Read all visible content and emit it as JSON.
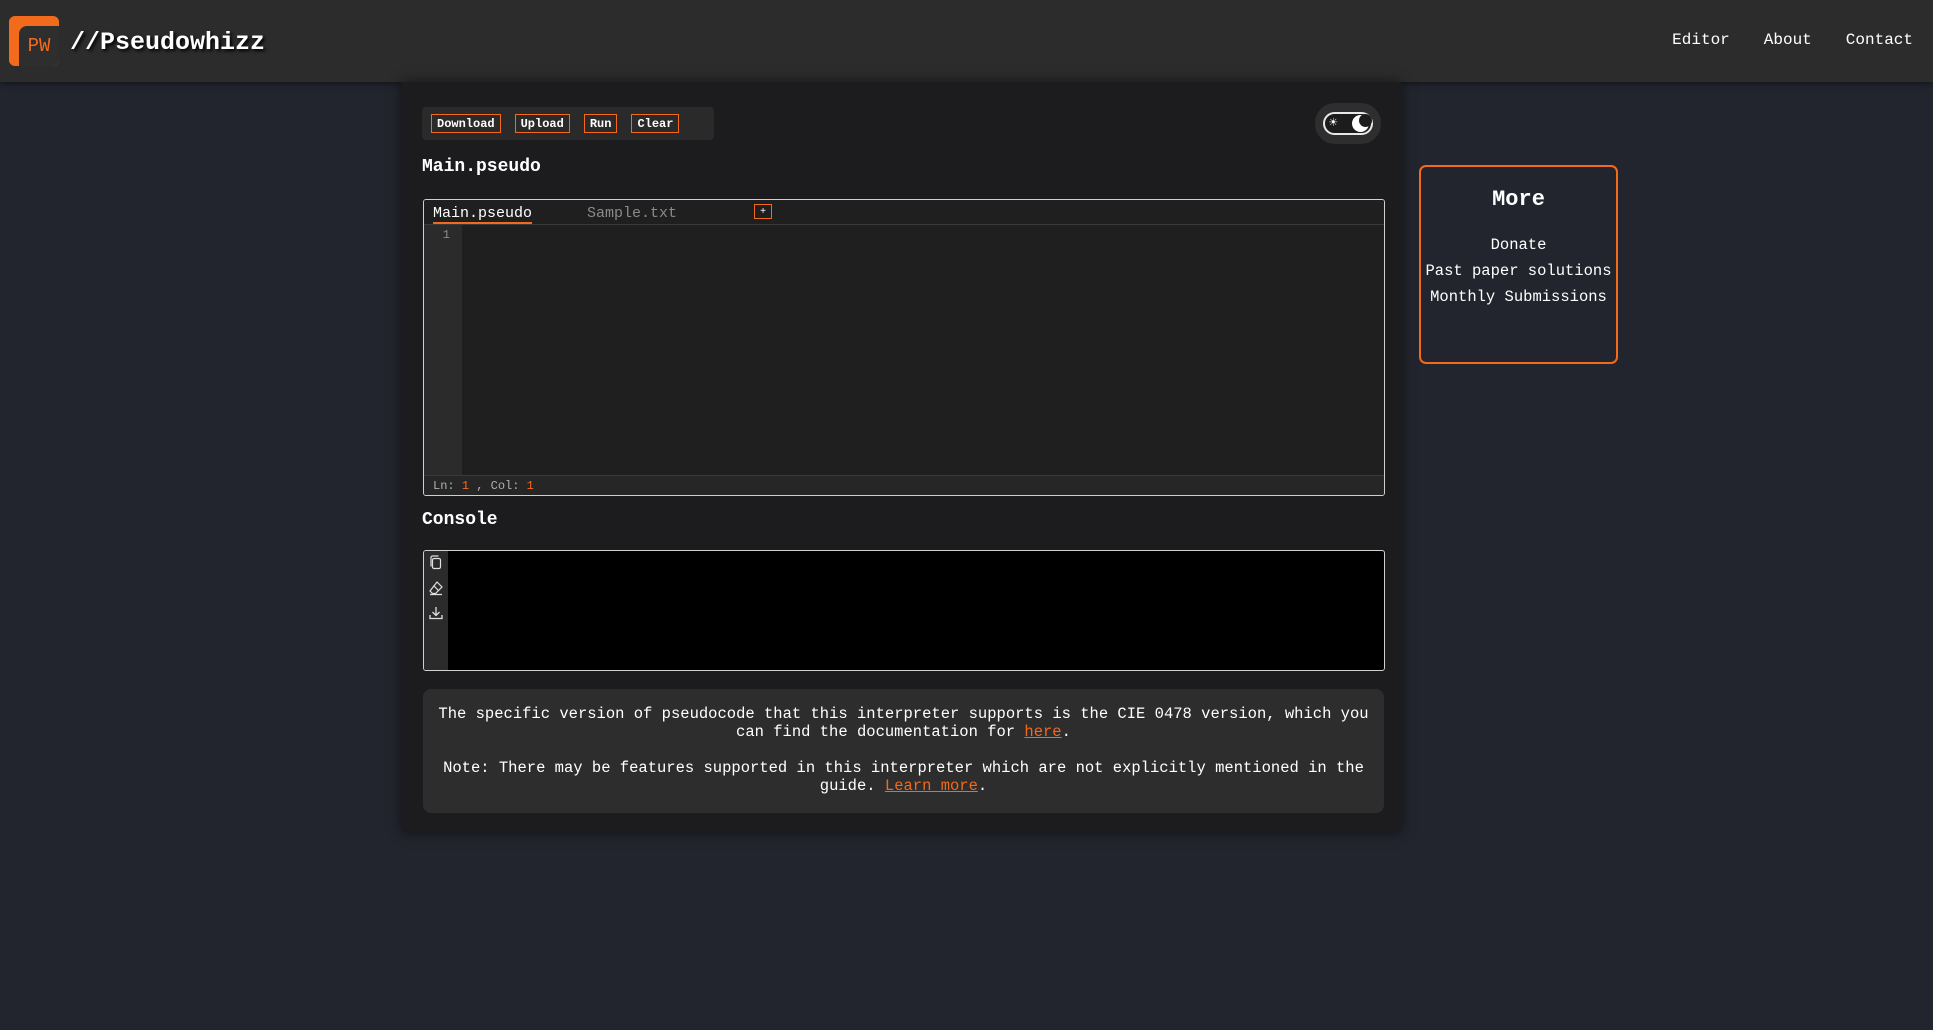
{
  "header": {
    "logo_text": "PW",
    "brand": "//Pseudowhizz",
    "nav": [
      "Editor",
      "About",
      "Contact"
    ]
  },
  "toolbar": {
    "buttons": [
      "Download",
      "Upload",
      "Run",
      "Clear"
    ]
  },
  "theme_toggle": {
    "mode": "dark"
  },
  "editor": {
    "file_title": "Main.pseudo",
    "tabs": [
      {
        "label": "Main.pseudo",
        "active": true
      },
      {
        "label": "Sample.txt",
        "active": false
      }
    ],
    "add_tab_label": "+",
    "line_numbers": [
      "1"
    ],
    "status": {
      "ln_label": "Ln:",
      "ln": "1",
      "col_label": ", Col:",
      "col": "1"
    }
  },
  "console": {
    "title": "Console",
    "icons": [
      "copy-icon",
      "eraser-icon",
      "download-icon"
    ]
  },
  "info": {
    "line1": "The specific version of pseudocode that this interpreter supports is the CIE 0478 version, which you can find the documentation for ",
    "line1_link": "here",
    "line1_end": ".",
    "line2": "Note: There may be features supported in this interpreter which are not explicitly mentioned in the guide. ",
    "line2_link": "Learn more",
    "line2_end": "."
  },
  "more": {
    "title": "More",
    "links": [
      "Donate",
      "Past paper solutions",
      "Monthly Submissions"
    ]
  },
  "colors": {
    "accent": "#f26a1b",
    "background": "#22252e",
    "panel": "#1c1c1e"
  }
}
